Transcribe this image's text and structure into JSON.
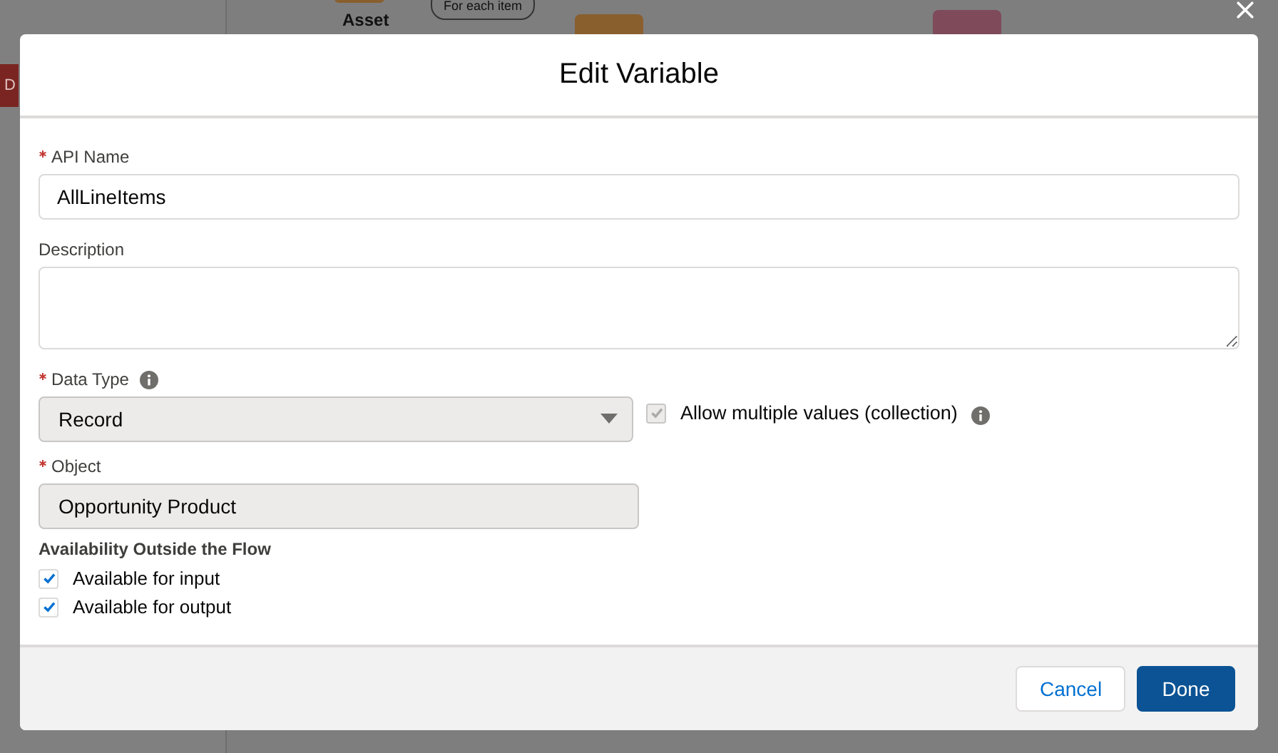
{
  "backdrop": {
    "side_button": "D",
    "node_label": "Asset",
    "connector_label": "For each item"
  },
  "modal": {
    "title": "Edit Variable",
    "api_name": {
      "label": "API Name",
      "required": true,
      "value": "AllLineItems"
    },
    "description": {
      "label": "Description"
    },
    "data_type": {
      "label": "Data Type",
      "required": true,
      "value": "Record",
      "collection": {
        "label": "Allow multiple values (collection)",
        "checked": true,
        "disabled": true
      }
    },
    "object": {
      "label": "Object",
      "required": true,
      "value": "Opportunity Product"
    },
    "availability": {
      "heading": "Availability Outside the Flow",
      "options": [
        {
          "label": "Available for input",
          "checked": true
        },
        {
          "label": "Available for output",
          "checked": true
        }
      ]
    },
    "buttons": [
      {
        "label": "Cancel",
        "kind": "neutral"
      },
      {
        "label": "Done",
        "kind": "brand"
      }
    ]
  }
}
